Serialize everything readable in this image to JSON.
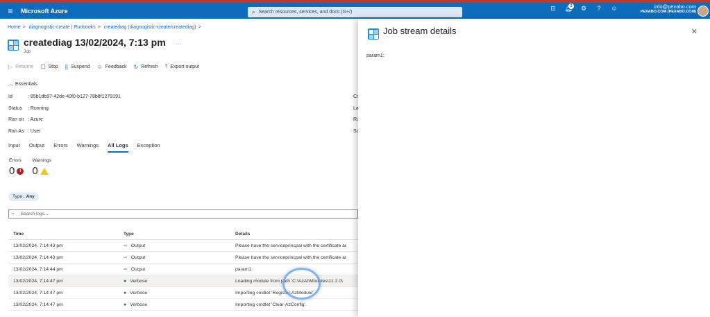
{
  "topbar": {
    "brand": "Microsoft Azure",
    "search_placeholder": "Search resources, services, and docs (G+/)",
    "notification_count": "2",
    "account_email": "info@pexabo.com",
    "account_tenant": "PEXABO.COM (PEXABO.COM)"
  },
  "breadcrumb": [
    "Home",
    "diagnogistic-create | Runbooks",
    "creatediag (diagnogistic-create/creatediag)"
  ],
  "page": {
    "title": "creatediag 13/02/2024, 7:13 pm",
    "more": "···",
    "subtitle": "Job"
  },
  "toolbar": {
    "resume": "Resume",
    "stop": "Stop",
    "suspend": "Suspend",
    "feedback": "Feedback",
    "refresh": "Refresh",
    "export": "Export output"
  },
  "essentials": {
    "label": "Essentials",
    "rows": [
      {
        "key": "Id",
        "value": ": 85b1db97-42de-40f0-b127-78b8f1279191",
        "right": "Cr"
      },
      {
        "key": "Status",
        "value": ": Running",
        "right": "La"
      },
      {
        "key": "Ran on",
        "value": ": Azure",
        "right": "Ru"
      },
      {
        "key": "Ran As",
        "value": ": User",
        "right": "So"
      }
    ]
  },
  "tabs": [
    "Input",
    "Output",
    "Errors",
    "Warnings",
    "All Logs",
    "Exception"
  ],
  "counts": {
    "errors_label": "Errors",
    "warnings_label": "Warnings",
    "errors": "0",
    "warnings": "0"
  },
  "filter": {
    "key": "Type : ",
    "value": "Any"
  },
  "log_search": {
    "placeholder": "Search logs..."
  },
  "table": {
    "headers": [
      "Time",
      "Type",
      "Details"
    ],
    "rows": [
      {
        "time": "13/02/2024, 7:14:43 pm",
        "type": "Output",
        "details": "Please have the serviceprincpal with the certificate ar"
      },
      {
        "time": "13/02/2024, 7:14:43 pm",
        "type": "Output",
        "details": "Please have the serviceprincpal with the certificate ar"
      },
      {
        "time": "13/02/2024, 7:14:44 pm",
        "type": "Output",
        "details": "param1:"
      },
      {
        "time": "13/02/2024, 7:14:47 pm",
        "type": "Verbose",
        "details": "Loading module from path 'C:\\AzAt\\Modules\\11.2.0\\"
      },
      {
        "time": "13/02/2024, 7:14:47 pm",
        "type": "Verbose",
        "details": "Importing cmdlet 'Register-AzModule'."
      },
      {
        "time": "13/02/2024, 7:14:47 pm",
        "type": "Verbose",
        "details": "Importing cmdlet 'Clear-AzConfig'."
      }
    ]
  },
  "panel": {
    "title": "Job stream details",
    "body": "param1:"
  }
}
